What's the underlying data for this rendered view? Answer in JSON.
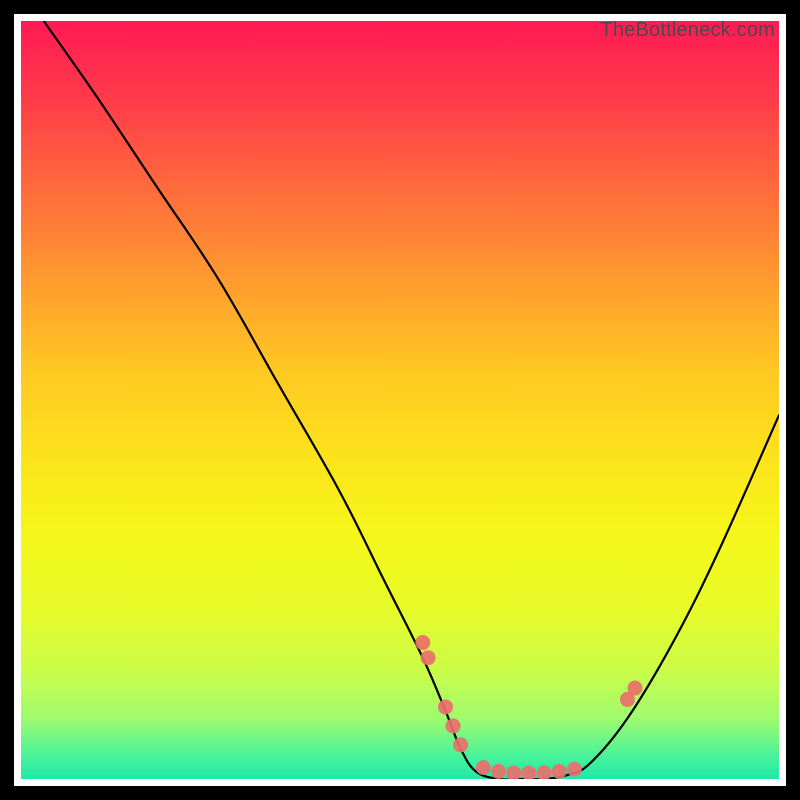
{
  "watermark": "TheBottleneck.com",
  "chart_data": {
    "type": "line",
    "title": "",
    "xlabel": "",
    "ylabel": "",
    "xlim": [
      0,
      100
    ],
    "ylim": [
      0,
      100
    ],
    "series": [
      {
        "name": "bottleneck-curve",
        "x": [
          3,
          10,
          18,
          26,
          34,
          42,
          48,
          53,
          56,
          58,
          60,
          63,
          66,
          69,
          72,
          75,
          80,
          86,
          92,
          100
        ],
        "y": [
          100,
          90,
          78,
          66,
          52,
          38,
          26,
          16,
          9,
          4,
          1,
          0,
          0,
          0,
          0.5,
          2,
          8,
          18,
          30,
          48
        ]
      }
    ],
    "markers": [
      {
        "x": 53.0,
        "y": 18.0
      },
      {
        "x": 53.7,
        "y": 16.0
      },
      {
        "x": 56.0,
        "y": 9.5
      },
      {
        "x": 57.0,
        "y": 7.0
      },
      {
        "x": 58.0,
        "y": 4.5
      },
      {
        "x": 61.0,
        "y": 1.5
      },
      {
        "x": 63.0,
        "y": 1.0
      },
      {
        "x": 65.0,
        "y": 0.8
      },
      {
        "x": 67.0,
        "y": 0.8
      },
      {
        "x": 69.0,
        "y": 0.8
      },
      {
        "x": 71.0,
        "y": 1.0
      },
      {
        "x": 73.0,
        "y": 1.3
      },
      {
        "x": 80.0,
        "y": 10.5
      },
      {
        "x": 81.0,
        "y": 12.0
      }
    ],
    "marker_color": "#e96f6c",
    "curve_color": "#000000"
  }
}
